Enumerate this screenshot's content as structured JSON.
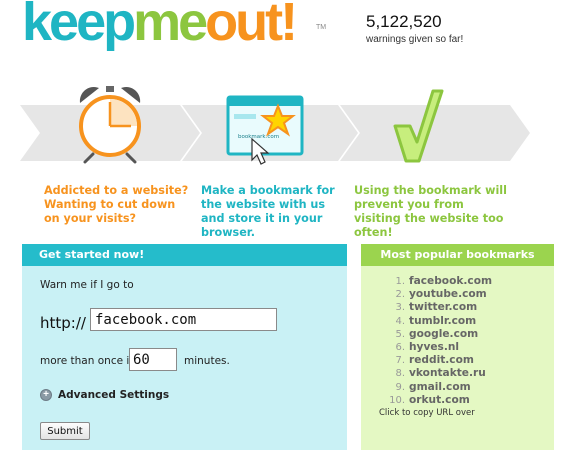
{
  "header": {
    "logo": {
      "keep": "keep",
      "me": "me",
      "out": "out",
      "bang": "!",
      "tm": "TM"
    },
    "counter_value": "5,122,520",
    "counter_caption": "warnings given so far!"
  },
  "illustration": {
    "browser_url_text": "bookmark.com"
  },
  "steps": [
    {
      "text": "Addicted to a website? Wanting to cut down on your visits?",
      "color": "#f7931e",
      "icon": "alarm-clock-icon"
    },
    {
      "text": "Make a bookmark for the website with us and store it in your browser.",
      "color": "#1fb5c3",
      "icon": "browser-bookmark-icon"
    },
    {
      "text": "Using the bookmark will prevent you from visiting the website too often!",
      "color": "#8cc63f",
      "icon": "checkmark-icon"
    }
  ],
  "form": {
    "header": "Get started now!",
    "warn_label": "Warn me if I go to",
    "http_label": "http://",
    "url_value": "facebook.com",
    "more_label": "more than once in",
    "minutes_value": "60",
    "minutes_label": "minutes.",
    "advanced_label": "Advanced Settings",
    "advanced_icon": "plus-circle-icon",
    "submit_label": "Submit"
  },
  "popular": {
    "header": "Most popular bookmarks",
    "items": [
      {
        "n": "1.",
        "url": "facebook.com"
      },
      {
        "n": "2.",
        "url": "youtube.com"
      },
      {
        "n": "3.",
        "url": "twitter.com"
      },
      {
        "n": "4.",
        "url": "tumblr.com"
      },
      {
        "n": "5.",
        "url": "google.com"
      },
      {
        "n": "6.",
        "url": "hyves.nl"
      },
      {
        "n": "7.",
        "url": "reddit.com"
      },
      {
        "n": "8.",
        "url": "vkontakte.ru"
      },
      {
        "n": "9.",
        "url": "gmail.com"
      },
      {
        "n": "10.",
        "url": "orkut.com"
      }
    ],
    "note": "Click to copy URL over"
  },
  "colors": {
    "teal": "#1fb5c3",
    "green": "#8cc63f",
    "orange": "#f7931e"
  }
}
